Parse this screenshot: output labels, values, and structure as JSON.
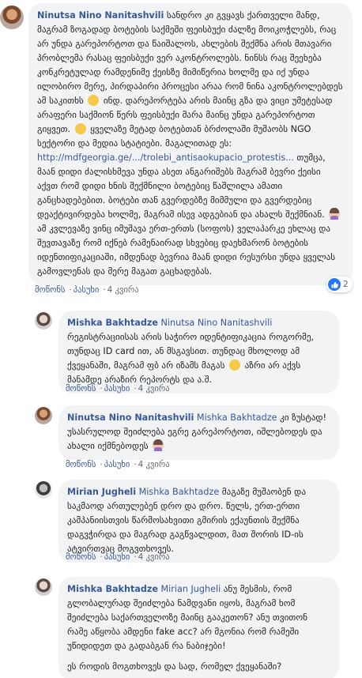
{
  "comments": [
    {
      "author": "Ninutsa Nino Nanitashvili",
      "text_1": "სანდრო კი გვყავს ქართველი მანდ, მაგრამ ზოგადად ბოტების საქმეში ფეისბუქი ძალზე მოიკოჭლებს, რაც არ უნდა გარეპორტოთ და წაიშალოს, ახლების შექმნა არის მთავარი პრობლემა რასაც ფეისბუქი ვერ აკონტროლებს. ნინსს რაც შეეხება კონკრეტულად რამდენიმე ქეისზე მიმიწერია ხოლმე და იქ უნდა ილობირო მერე, პირდაპირი პროცესი არაა რომ ნინა აკონტროლებდეს ამ საკითხს",
      "text_2": "ინდ. დარეპორტება არის მაინც გზა და ვიცი უმეტესად არაფერი საქმიონ წერს ფეისბუქი მარა მაინც უნდა გარეპორტოთ გიყვეთ.",
      "text_3": "ყველაზე მეტად ბოტებთან ბრძოლაში მუშაობს NGO სექტორი და მედია სტატიები. მაგალითად ეს:",
      "link": "http://mdfgeorgia.ge/.../trolebi_antisaokupacio_protestis...",
      "text_4": " თუმცა, მაან დიდი ძალისხმევა უნდა ასეთ ანგარიშებს მაგრამ ბევრი ქეისი აქვთ რომ დიდი ხნის შექმნილი ბოტებიც წაშლილა ამათი განცხადებებით. ბოტები თან გვერდებზე მიმმული და გვერდებიც დეაქტივირდება ხოლმე, მაგრამ ისევ ადგებიან და ახალს შექმნიან.",
      "text_5": "ამ კვლევაზე ვინც იმუშავა ერთ-ერთს (სოფოს) ველაპარკე ეხლაც და შევთავაზე რომ იქნებ რამენაირად სხვებიც დაეხმარონ ბოტების იდენთიფიკაციაში, იმდენად ბევრია მაან დიდი რესურსი უნდა ყველას გამოვლენას და მერე მაგათ გაცხადებას.",
      "time": "4 კვირა"
    },
    {
      "author": "Mishka Bakhtadze",
      "mention": "Ninutsa Nino Nanitashvili",
      "text_1": "რეგისტრაციისას არის საჭირო იდენტიფიკაცია როგორმე, თუნდაც ID card ით, ან მსგავსით. თუნდაც მხოლოდ ამ ქვეყანაში, მაგრამ ფბ არ იზამს მაგას",
      "text_2": "აზრი არ აქვს მანამდე არაზირ რეპორტს და ა.შ.",
      "time": "4 კვირა"
    },
    {
      "author": "Ninutsa Nino Nanitashvili",
      "mention": "Mishka Bakhtadze",
      "text_1": "კი ზუსტად! უსასრულოდ შეიძლება ეგრე გარეპორტოთ, იშლებოდეს და ახალი იქმნებოდეს",
      "time": "4 კვირა"
    },
    {
      "author": "Mirian Jugheli",
      "mention": "Mishka Bakhtadze",
      "text_1": "მაგაზე მუშაობენ და საკმაოდ ართულებენ დრო და დრო. წელს, ერთ-ერთი კამპანიისთვის წარმოსახვითი გმირის ექაუნთის შექმნა დაგვჭირდა და მაგრად გაგწვალდით, მათ შორის ID-ის ატვირთვაც მოგვთხოვეს.",
      "time": "4 კვირა"
    },
    {
      "author": "Mishka Bakhtadze",
      "mention": "Mirian Jugheli",
      "text_1": "ანუ მესმის, რომ გლობალურად შეიძლება ნამდვანი იყოს, მაგრამ ხომ შეიძლება საქართველოზე მაინც გააკეთონ? ანუ თვითონ რამე აწყობა ამდენი fake acc? არ მგონია რომ რამეში უწიდიდეთ და გადაბგან რა ნაბიჯები!",
      "text_2": "ეს როდის მოგთხოვეს და სად, რომელ ქვეყანაში?",
      "time": ""
    }
  ],
  "ui": {
    "like_label": "მოწონს",
    "reply_label": "პასუხი",
    "separator": "·",
    "reaction_count": "2"
  }
}
